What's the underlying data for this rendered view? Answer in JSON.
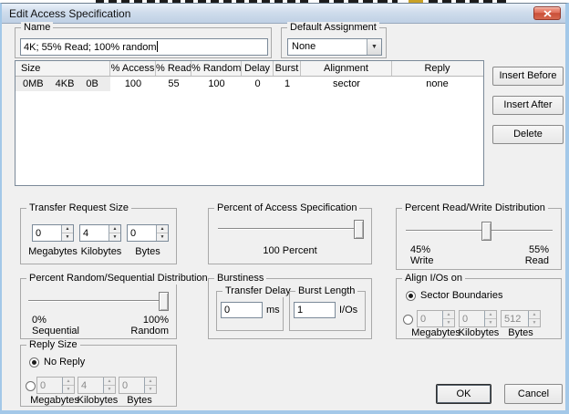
{
  "window": {
    "title": "Edit Access Specification"
  },
  "icons": {
    "spinner_up": "▲",
    "spinner_down": "▼",
    "combo_arrow": "▼"
  },
  "name_group": {
    "label": "Name",
    "value": "4K; 55% Read; 100% random"
  },
  "default_assignment": {
    "label": "Default Assignment",
    "value": "None"
  },
  "spec_table": {
    "columns": [
      "Size",
      "% Access",
      "% Read",
      "% Random",
      "Delay",
      "Burst",
      "Alignment",
      "Reply"
    ],
    "rows": [
      {
        "size": [
          "0MB",
          "4KB",
          "0B"
        ],
        "values": [
          "100",
          "55",
          "100",
          "0",
          "1",
          "sector",
          "none"
        ]
      }
    ]
  },
  "list_buttons": {
    "insert_before": "Insert Before",
    "insert_after": "Insert After",
    "delete": "Delete"
  },
  "transfer_request_size": {
    "label": "Transfer Request Size",
    "megabytes": "0",
    "kilobytes": "4",
    "bytes": "0",
    "unit_labels": [
      "Megabytes",
      "Kilobytes",
      "Bytes"
    ]
  },
  "percent_access": {
    "label": "Percent of Access Specification",
    "value_label": "100 Percent",
    "slider_percent": 100
  },
  "read_write": {
    "label": "Percent Read/Write Distribution",
    "left_value": "45%",
    "left_label": "Write",
    "right_value": "55%",
    "right_label": "Read",
    "slider_percent": 55
  },
  "random_seq": {
    "label": "Percent Random/Sequential Distribution",
    "left_value": "0%",
    "left_label": "Sequential",
    "right_value": "100%",
    "right_label": "Random",
    "slider_percent": 100
  },
  "burstiness": {
    "label": "Burstiness",
    "transfer_delay": {
      "label": "Transfer Delay",
      "value": "0",
      "unit": "ms"
    },
    "burst_length": {
      "label": "Burst Length",
      "value": "1",
      "unit": "I/Os"
    }
  },
  "align_ios": {
    "label": "Align I/Os on",
    "sector_option": "Sector Boundaries",
    "megabytes": "0",
    "kilobytes": "0",
    "bytes": "512",
    "unit_labels": [
      "Megabytes",
      "Kilobytes",
      "Bytes"
    ]
  },
  "reply_size": {
    "label": "Reply Size",
    "no_reply_option": "No Reply",
    "megabytes": "0",
    "kilobytes": "4",
    "bytes": "0",
    "unit_labels": [
      "Megabytes",
      "Kilobytes",
      "Bytes"
    ]
  },
  "footer": {
    "ok": "OK",
    "cancel": "Cancel"
  },
  "colors": {
    "titlebar_top": "#eaf1f9",
    "titlebar_bottom": "#bfd0e4",
    "window_border": "#a3c8e8",
    "dialog_bg": "#f0f0f0",
    "close_button_red": "#cf4c35",
    "selection_bg": "#ececec"
  }
}
